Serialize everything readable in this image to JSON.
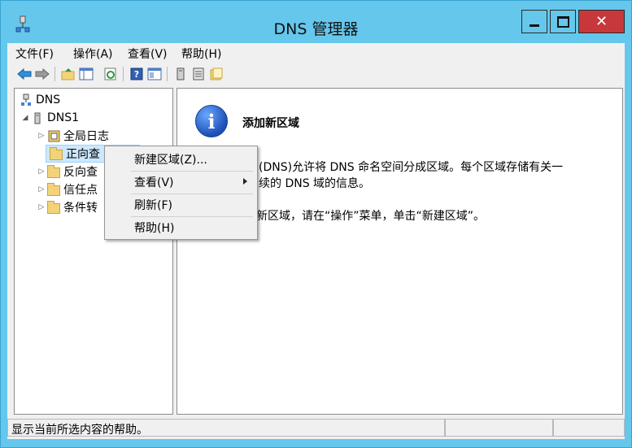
{
  "window": {
    "title": "DNS 管理器"
  },
  "title_buttons": {
    "minimize": "—",
    "maximize": "▢",
    "close": "✕"
  },
  "menu": [
    "文件(F)",
    "操作(A)",
    "查看(V)",
    "帮助(H)"
  ],
  "toolbar_icons": [
    "back-arrow-icon",
    "forward-arrow-icon",
    "up-folder-icon",
    "show-hide-console-tree-icon",
    "refresh-icon",
    "help-icon",
    "properties-icon",
    "server-icon",
    "list-icon",
    "zone-icon"
  ],
  "tree": {
    "root": "DNS",
    "server": "DNS1",
    "nodes": [
      "全局日志",
      "正向查",
      "反向查",
      "信任点",
      "条件转"
    ]
  },
  "detail": {
    "heading": "添加新区域",
    "line1": "(DNS)允许将 DNS 命名空间分成区域。每个区域存储有关一",
    "line2": "续的 DNS 域的信息。",
    "line3": "新区域，请在“操作”菜单，单击“新建区域”。"
  },
  "context_menu": {
    "items": [
      "新建区域(Z)...",
      "查看(V)",
      "刷新(F)",
      "帮助(H)"
    ]
  },
  "status": {
    "text": "显示当前所选内容的帮助。"
  },
  "colors": {
    "frame": "#65c7ec",
    "close": "#c7383b",
    "selection": "#cce8ff"
  }
}
